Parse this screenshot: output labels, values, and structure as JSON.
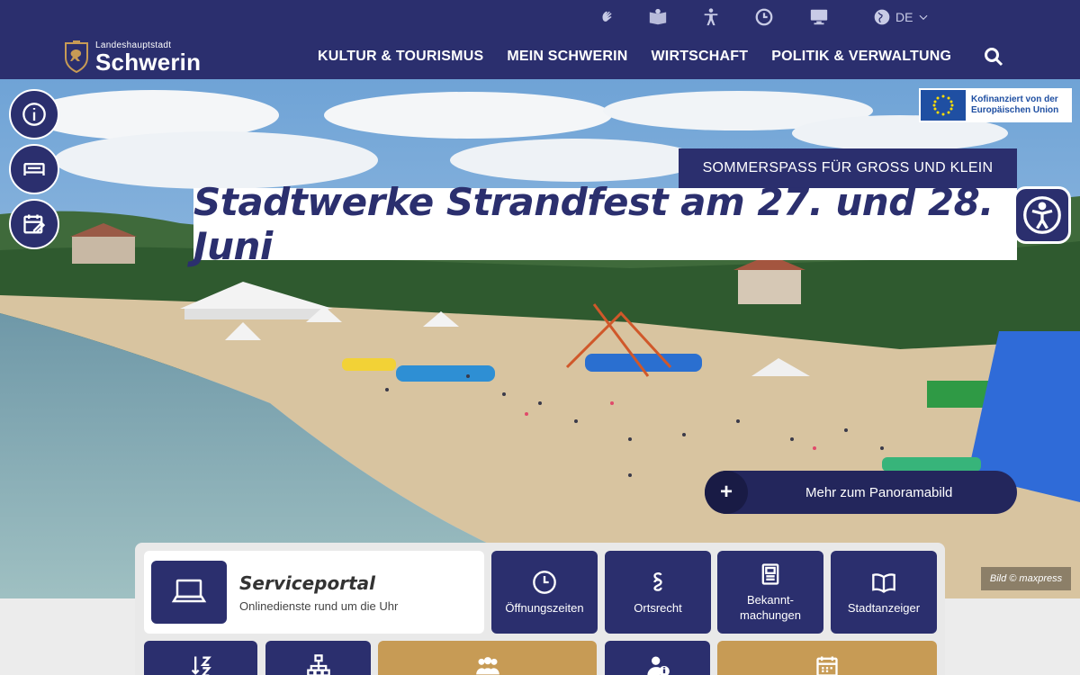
{
  "utility_bar": {
    "icons": [
      "sign-language-icon",
      "easy-read-icon",
      "accessibility-person-icon",
      "clock-icon",
      "monitor-icon"
    ],
    "language": "DE"
  },
  "header": {
    "logo_small": "Landeshauptstadt",
    "logo_big": "Schwerin",
    "nav": [
      "KULTUR & TOURISMUS",
      "MEIN SCHWERIN",
      "WIRTSCHAFT",
      "POLITIK & VERWALTUNG"
    ]
  },
  "hero": {
    "eu_badge": "Kofinanziert von der Europäischen Union",
    "kicker": "SOMMERSPASS FÜR GROSS UND KLEIN",
    "headline": "Stadtwerke Strandfest am 27. und 28. Juni",
    "more_button": "Mehr zum Panoramabild",
    "more_plus": "+",
    "credit": "Bild © maxpress"
  },
  "services": {
    "portal_title": "Serviceportal",
    "portal_subtitle": "Onlinedienste rund um die Uhr",
    "tiles": [
      {
        "label": "Öffnungszeiten",
        "icon": "clock-icon"
      },
      {
        "label": "Ortsrecht",
        "icon": "paragraph-icon"
      },
      {
        "label": "Bekannt-\nmachungen",
        "icon": "newspaper-icon"
      },
      {
        "label": "Stadtanzeiger",
        "icon": "book-icon"
      }
    ],
    "row2_icons": [
      "sort-az-icon",
      "org-chart-icon",
      "people-icon",
      "person-info-icon",
      "calendar-icon"
    ]
  },
  "colors": {
    "primary": "#2b2f6e",
    "gold": "#c79b55",
    "eu_blue": "#1f4fa2"
  }
}
